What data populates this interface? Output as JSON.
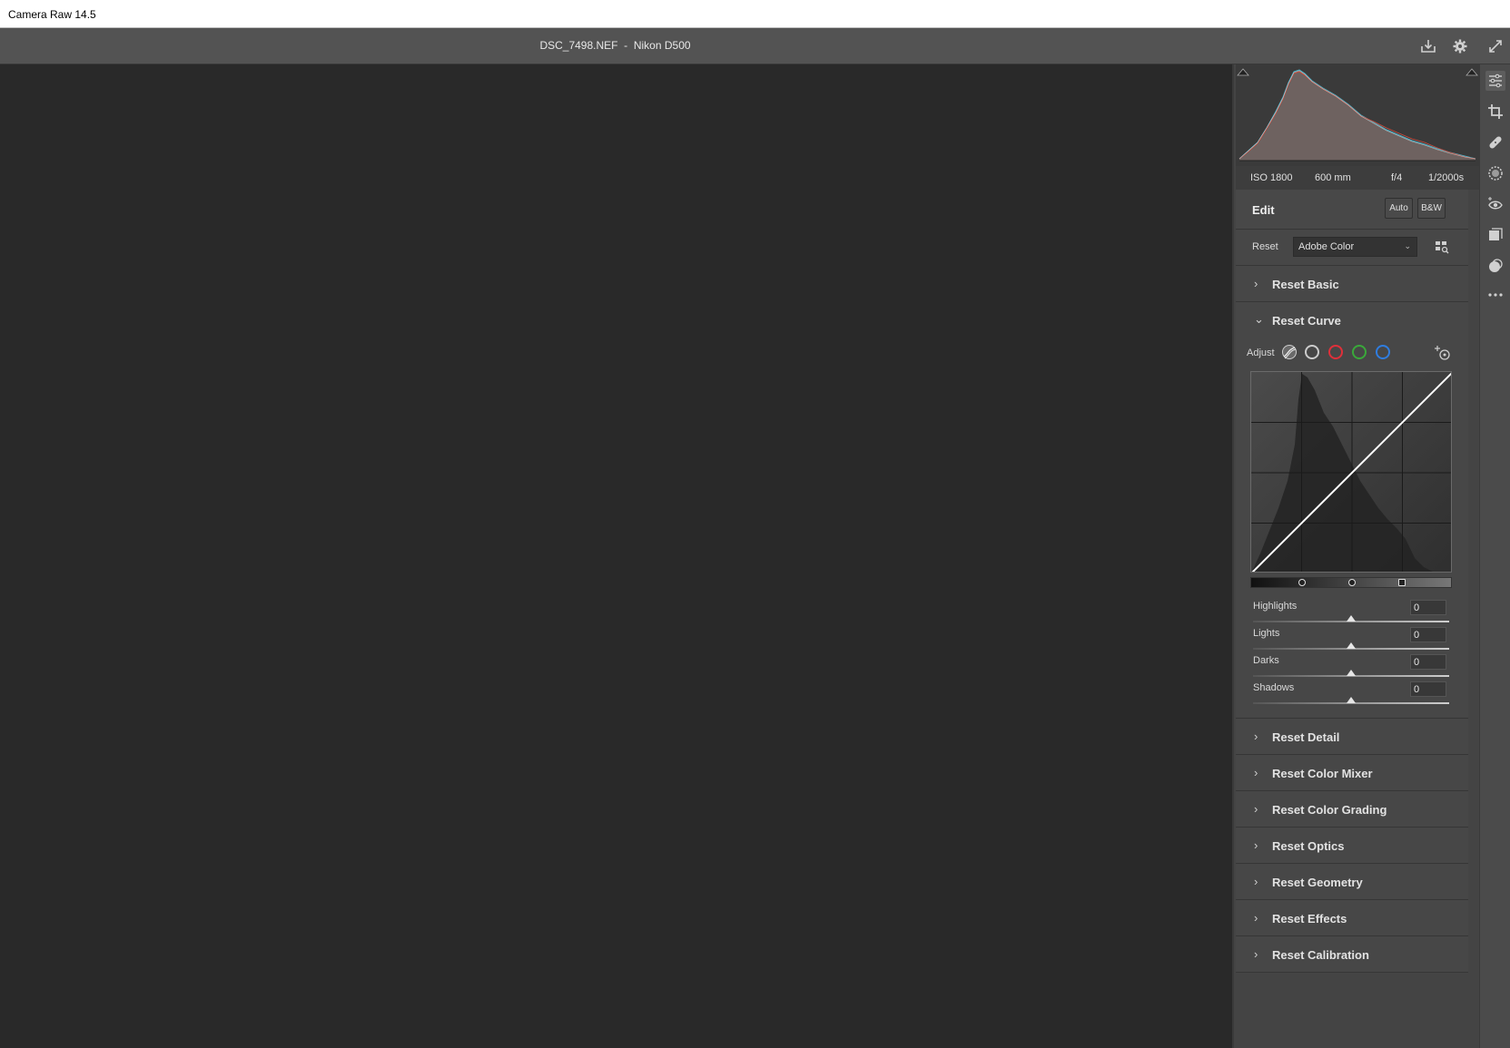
{
  "app": {
    "window_title": "Camera Raw 14.5"
  },
  "topbar": {
    "file_name": "DSC_7498.NEF",
    "separator": "-",
    "camera": "Nikon D500"
  },
  "exif": {
    "iso": "ISO 1800",
    "focal": "600 mm",
    "aperture": "f/4",
    "shutter": "1/2000s"
  },
  "edit": {
    "title": "Edit",
    "auto_label": "Auto",
    "bw_label": "B&W"
  },
  "profile": {
    "label": "Reset",
    "value": "Adobe Color"
  },
  "sections_top": [
    {
      "label": "Reset Basic",
      "expanded": false
    }
  ],
  "curve": {
    "title": "Reset Curve",
    "adjust_label": "Adjust",
    "channel_colors": {
      "rgb": "#cccccc",
      "red": "#e0303a",
      "green": "#3aa83a",
      "blue": "#2f7de0"
    },
    "sliders": [
      {
        "label": "Highlights",
        "value": "0",
        "fraction": 0.5
      },
      {
        "label": "Lights",
        "value": "0",
        "fraction": 0.5
      },
      {
        "label": "Darks",
        "value": "0",
        "fraction": 0.5
      },
      {
        "label": "Shadows",
        "value": "0",
        "fraction": 0.5
      }
    ]
  },
  "sections_bottom": [
    {
      "label": "Reset Detail"
    },
    {
      "label": "Reset Color Mixer"
    },
    {
      "label": "Reset Color Grading"
    },
    {
      "label": "Reset Optics"
    },
    {
      "label": "Reset Geometry"
    },
    {
      "label": "Reset Effects"
    },
    {
      "label": "Reset Calibration"
    }
  ],
  "tools": [
    "sliders-icon",
    "crop-icon",
    "heal-icon",
    "mask-icon",
    "red-eye-icon",
    "presets-icon",
    "snapshots-icon",
    "more-icon"
  ]
}
